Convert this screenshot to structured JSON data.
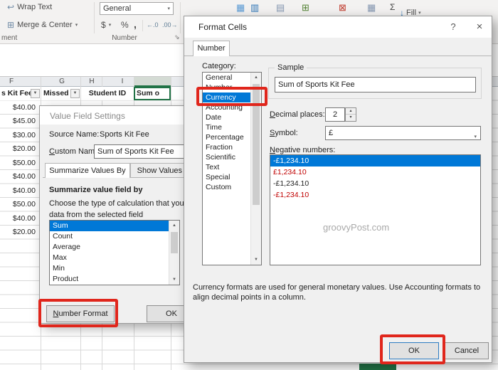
{
  "colors": {
    "selection_blue": "#0078d7",
    "annotation_red": "#e0261c",
    "negative_red": "#c00000",
    "excel_green": "#217346"
  },
  "icons": {
    "caret": "▾",
    "wrap_text": "↩",
    "merge_center": "⊞",
    "currency": "$",
    "percent": "%",
    "comma": ",",
    "increase_decimal": "←.0",
    "decrease_decimal": ".00→",
    "dialog_launcher": "⇘",
    "conditional_formatting": "▦",
    "format_as_table": "▥",
    "cell_styles": "▤",
    "insert_cells": "⊞",
    "delete_cells": "⊠",
    "format_cells": "▦",
    "autosum": "Σ",
    "fill": "↓",
    "help": "?",
    "close": "×",
    "spin_up": "▴",
    "spin_down": "▾",
    "scroll_up": "▲",
    "scroll_down": "▼",
    "filter": "▼"
  },
  "ribbon": {
    "wrap_text_label": "Wrap Text",
    "merge_center_label": "Merge & Center",
    "number_format_value": "General",
    "alignment_group_label": "ment",
    "number_group_label": "Number",
    "fill_label": "Fill"
  },
  "sheet": {
    "column_letters": [
      "F",
      "G",
      "H",
      "I"
    ],
    "header_cells": {
      "f": "s Kit Fee",
      "g": "Missed C",
      "hi": "Student ID",
      "j": "Sum o"
    },
    "f_values": [
      "$40.00",
      "$45.00",
      "$30.00",
      "$20.00",
      "$50.00",
      "$40.00",
      "$40.00",
      "$50.00",
      "$40.00",
      "$20.00"
    ]
  },
  "value_field_settings": {
    "title": "Value Field Settings",
    "source_name_label": "Source Name:",
    "source_name_value": "Sports Kit Fee",
    "custom_name_label": "Custom Name:",
    "custom_name_value": "Sum of Sports Kit Fee",
    "tab_summarize": "Summarize Values By",
    "tab_show": "Show Values As",
    "section_title": "Summarize value field by",
    "description_line1": "Choose the type of calculation that you want",
    "description_line2": "data from the selected field",
    "options": [
      "Sum",
      "Count",
      "Average",
      "Max",
      "Min",
      "Product"
    ],
    "selected_option": "Sum",
    "number_format_button": "Number Format",
    "ok_button": "OK"
  },
  "format_cells": {
    "title": "Format Cells",
    "tab_number": "Number",
    "category_label": "Category:",
    "categories": [
      "General",
      "Number",
      "Currency",
      "Accounting",
      "Date",
      "Time",
      "Percentage",
      "Fraction",
      "Scientific",
      "Text",
      "Special",
      "Custom"
    ],
    "selected_category": "Currency",
    "sample_group_label": "Sample",
    "sample_value": "Sum of Sports Kit Fee",
    "decimal_places_label": "Decimal places:",
    "decimal_places_value": "2",
    "symbol_label": "Symbol:",
    "symbol_value": "£",
    "negative_numbers_label": "Negative numbers:",
    "negative_numbers": [
      {
        "text": "-£1,234.10",
        "style": "selected"
      },
      {
        "text": "£1,234.10",
        "style": "red"
      },
      {
        "text": "-£1,234.10",
        "style": "black"
      },
      {
        "text": "-£1,234.10",
        "style": "red"
      }
    ],
    "watermark": "groovyPost.com",
    "description": "Currency formats are used for general monetary values.  Use Accounting formats to align decimal points in a column.",
    "ok_button": "OK",
    "cancel_button": "Cancel"
  }
}
